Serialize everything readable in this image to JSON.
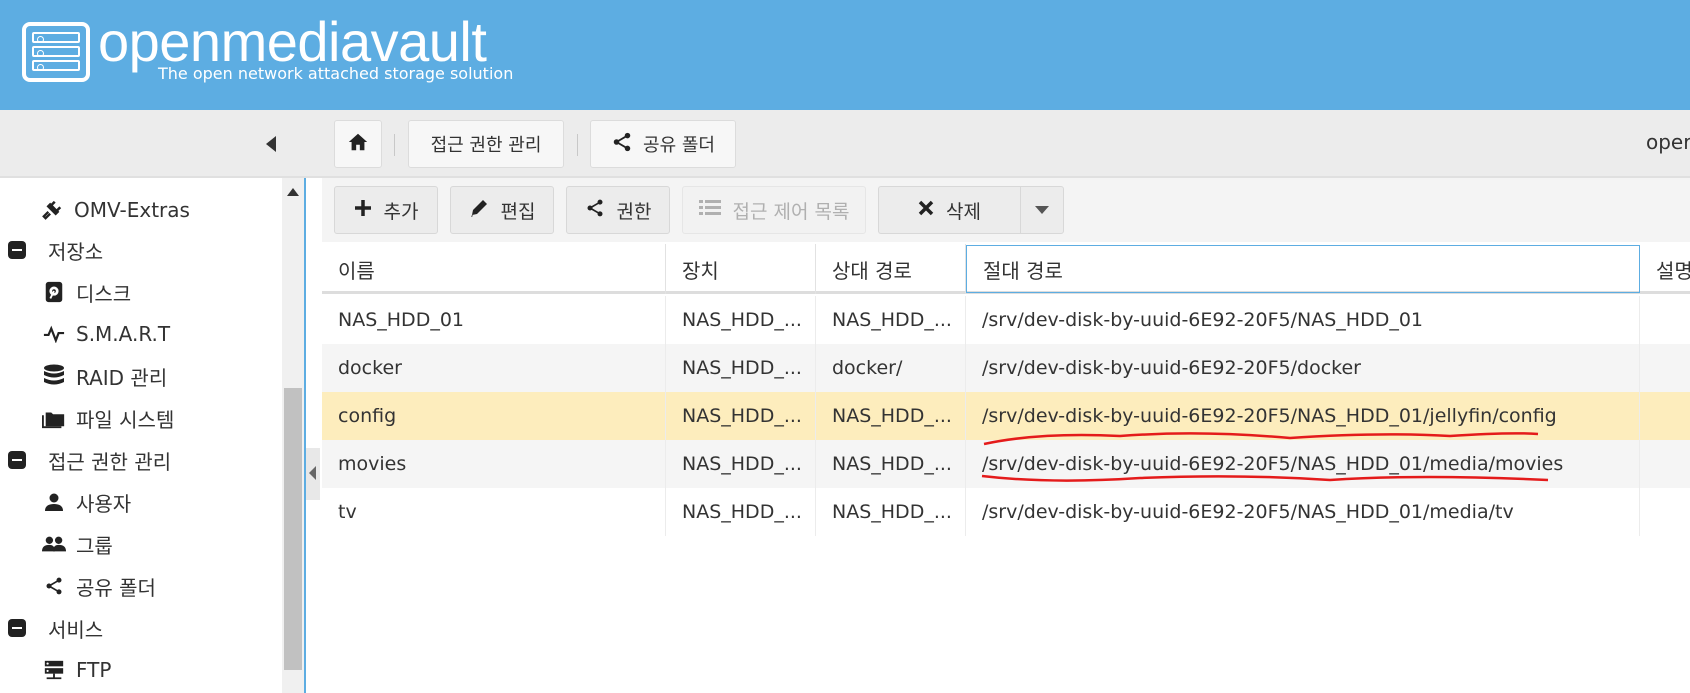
{
  "header": {
    "app_name": "openmediavault",
    "tagline": "The open network attached storage solution"
  },
  "breadcrumb": {
    "home_icon": "home-icon",
    "items": [
      "접근 권한 관리",
      "공유 폴더"
    ],
    "user_partial": "oper"
  },
  "sidebar": {
    "items": [
      {
        "label": "OMV-Extras",
        "icon": "plug-icon",
        "type": "item"
      },
      {
        "label": "저장소",
        "icon": "minus-square-icon",
        "type": "section"
      },
      {
        "label": "디스크",
        "icon": "disk-icon",
        "type": "item"
      },
      {
        "label": "S.M.A.R.T",
        "icon": "pulse-icon",
        "type": "item"
      },
      {
        "label": "RAID 관리",
        "icon": "database-icon",
        "type": "item"
      },
      {
        "label": "파일 시스템",
        "icon": "folder-icon",
        "type": "item"
      },
      {
        "label": "접근 권한 관리",
        "icon": "minus-square-icon",
        "type": "section"
      },
      {
        "label": "사용자",
        "icon": "user-icon",
        "type": "item"
      },
      {
        "label": "그룹",
        "icon": "group-icon",
        "type": "item"
      },
      {
        "label": "공유 폴더",
        "icon": "share-icon",
        "type": "item"
      },
      {
        "label": "서비스",
        "icon": "minus-square-icon",
        "type": "section"
      },
      {
        "label": "FTP",
        "icon": "server-icon",
        "type": "item"
      }
    ]
  },
  "toolbar": {
    "add_label": "추가",
    "edit_label": "편집",
    "perm_label": "권한",
    "acl_label": "접근 제어 목록",
    "delete_label": "삭제"
  },
  "grid": {
    "columns": [
      "이름",
      "장치",
      "상대 경로",
      "절대 경로",
      "설명"
    ],
    "rows": [
      {
        "name": "NAS_HDD_01",
        "device": "NAS_HDD_...",
        "relpath": "NAS_HDD_...",
        "abspath": "/srv/dev-disk-by-uuid-6E92-20F5/NAS_HDD_01",
        "selected": false
      },
      {
        "name": "docker",
        "device": "NAS_HDD_...",
        "relpath": "docker/",
        "abspath": "/srv/dev-disk-by-uuid-6E92-20F5/docker",
        "selected": false
      },
      {
        "name": "config",
        "device": "NAS_HDD_...",
        "relpath": "NAS_HDD_...",
        "abspath": "/srv/dev-disk-by-uuid-6E92-20F5/NAS_HDD_01/jellyfin/config",
        "selected": true
      },
      {
        "name": "movies",
        "device": "NAS_HDD_...",
        "relpath": "NAS_HDD_...",
        "abspath": "/srv/dev-disk-by-uuid-6E92-20F5/NAS_HDD_01/media/movies",
        "selected": false
      },
      {
        "name": "tv",
        "device": "NAS_HDD_...",
        "relpath": "NAS_HDD_...",
        "abspath": "/srv/dev-disk-by-uuid-6E92-20F5/NAS_HDD_01/media/tv",
        "selected": false
      }
    ]
  },
  "colors": {
    "header_bg": "#5dade2",
    "selected_row": "#fdedbd",
    "annotation": "#e41b1b"
  }
}
